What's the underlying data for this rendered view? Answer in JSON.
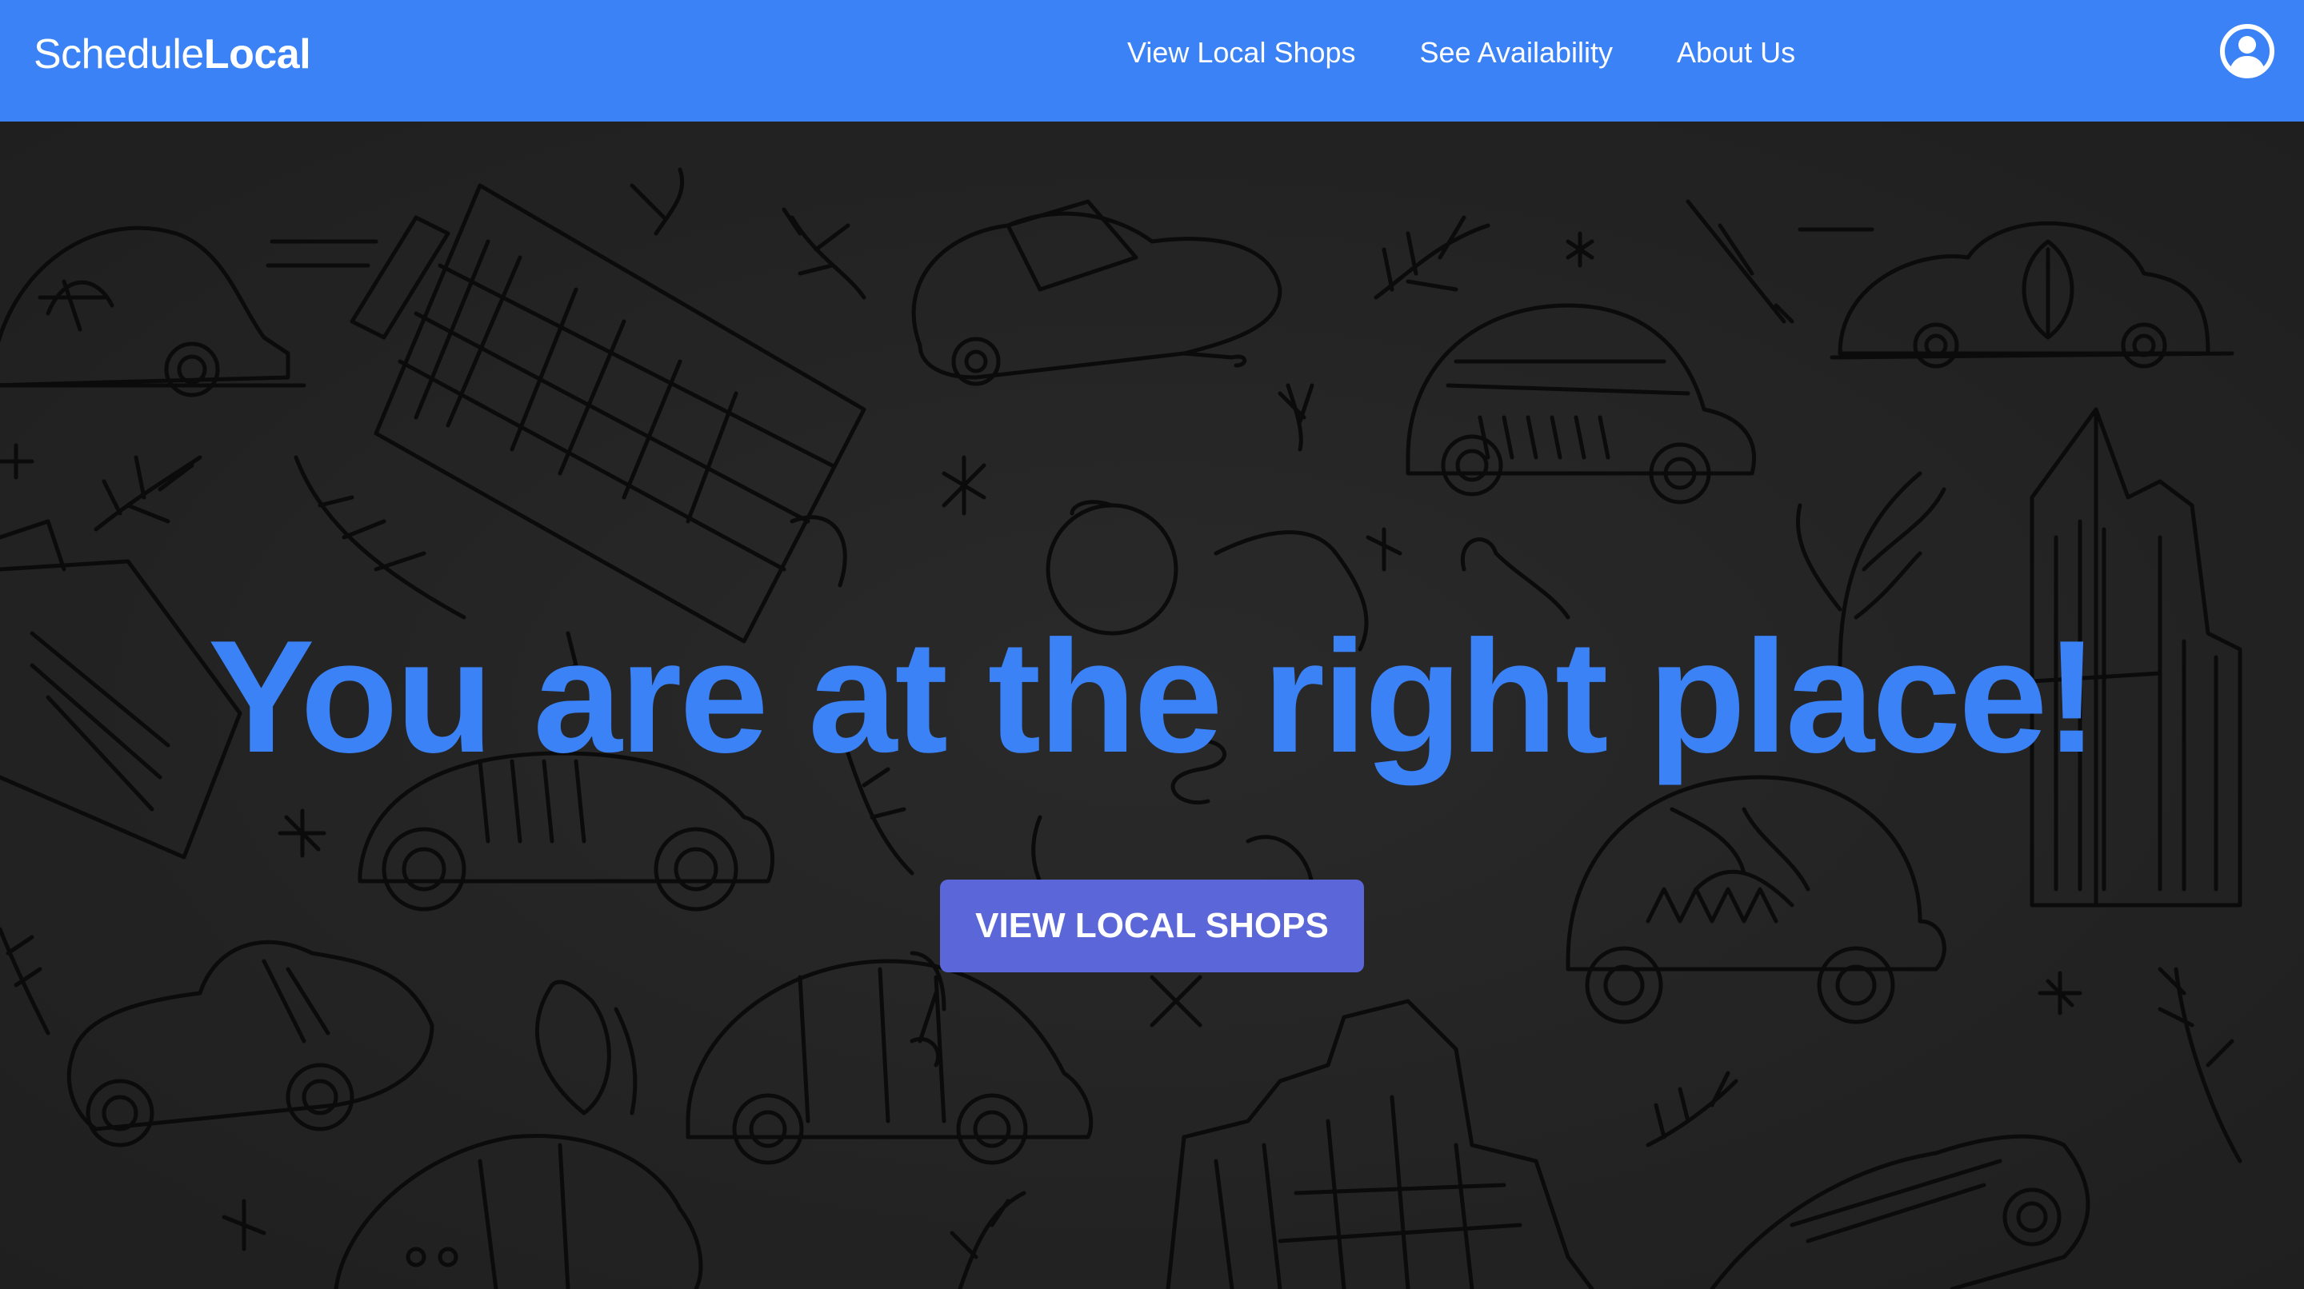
{
  "header": {
    "brand_regular": "Schedule",
    "brand_bold": "Local",
    "nav": [
      {
        "label": "View Local Shops"
      },
      {
        "label": "See Availability"
      },
      {
        "label": "About Us"
      }
    ],
    "profile_icon": "user-circle-icon"
  },
  "hero": {
    "headline": "You are at the right place!",
    "cta_label": "VIEW LOCAL SHOPS",
    "background_illustration": "doodle-pattern-cars-buildings-plants"
  },
  "colors": {
    "navbar": "#3b82f6",
    "headline": "#3b82f6",
    "cta": "#5b67d8",
    "background": "#232323"
  }
}
